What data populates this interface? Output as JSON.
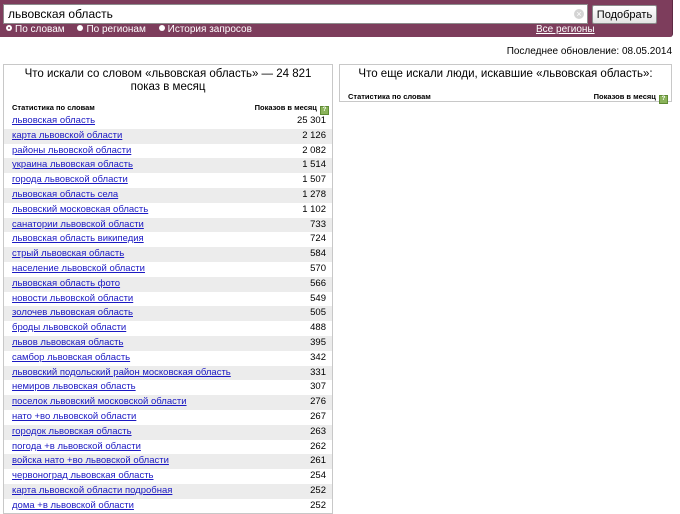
{
  "search": {
    "value": "львовская область",
    "submit_label": "Подобрать"
  },
  "modes": [
    {
      "label": "По словам",
      "checked": true
    },
    {
      "label": "По регионам",
      "checked": false
    },
    {
      "label": "История запросов",
      "checked": false
    }
  ],
  "all_regions_label": "Все регионы",
  "updated": "Последнее обновление: 08.05.2014",
  "left_panel": {
    "title": "Что искали со словом «львовская область» — 24 821 показ в месяц",
    "col_stats": "Статистика по словам",
    "col_shows": "Показов в месяц",
    "rows": [
      {
        "keyword": "львовская область",
        "count": "25 301"
      },
      {
        "keyword": "карта львовской области",
        "count": "2 126"
      },
      {
        "keyword": "районы львовской области",
        "count": "2 082"
      },
      {
        "keyword": "украина львовская область",
        "count": "1 514"
      },
      {
        "keyword": "города львовской области",
        "count": "1 507"
      },
      {
        "keyword": "львовская область села",
        "count": "1 278"
      },
      {
        "keyword": "львовский московская область",
        "count": "1 102"
      },
      {
        "keyword": "санатории львовской области",
        "count": "733"
      },
      {
        "keyword": "львовская область википедия",
        "count": "724"
      },
      {
        "keyword": "стрый львовская область",
        "count": "584"
      },
      {
        "keyword": "население львовской области",
        "count": "570"
      },
      {
        "keyword": "львовская область фото",
        "count": "566"
      },
      {
        "keyword": "новости львовской области",
        "count": "549"
      },
      {
        "keyword": "золочев львовская область",
        "count": "505"
      },
      {
        "keyword": "броды львовской области",
        "count": "488"
      },
      {
        "keyword": "львов львовская область",
        "count": "395"
      },
      {
        "keyword": "самбор львовская область",
        "count": "342"
      },
      {
        "keyword": "львовский подольский район московская область",
        "count": "331"
      },
      {
        "keyword": "немиров львовская область",
        "count": "307"
      },
      {
        "keyword": "поселок львовский московской области",
        "count": "276"
      },
      {
        "keyword": "нато +во львовской области",
        "count": "267"
      },
      {
        "keyword": "городок львовская область",
        "count": "263"
      },
      {
        "keyword": "погода +в львовской области",
        "count": "262"
      },
      {
        "keyword": "войска нато +во львовской области",
        "count": "261"
      },
      {
        "keyword": "червоноград львовская область",
        "count": "254"
      },
      {
        "keyword": "карта львовской области подробная",
        "count": "252"
      },
      {
        "keyword": "дома +в львовской области",
        "count": "252"
      }
    ]
  },
  "right_panel": {
    "title": "Что еще искали люди, искавшие «львовская область»:",
    "col_stats": "Статистика по словам",
    "col_shows": "Показов в месяц"
  },
  "colors": {
    "topbar": "#7d3d5c",
    "link": "#1b19c3",
    "row_alt": "#ececec"
  },
  "icons": {
    "clear": "close-icon",
    "info": "info-icon"
  }
}
